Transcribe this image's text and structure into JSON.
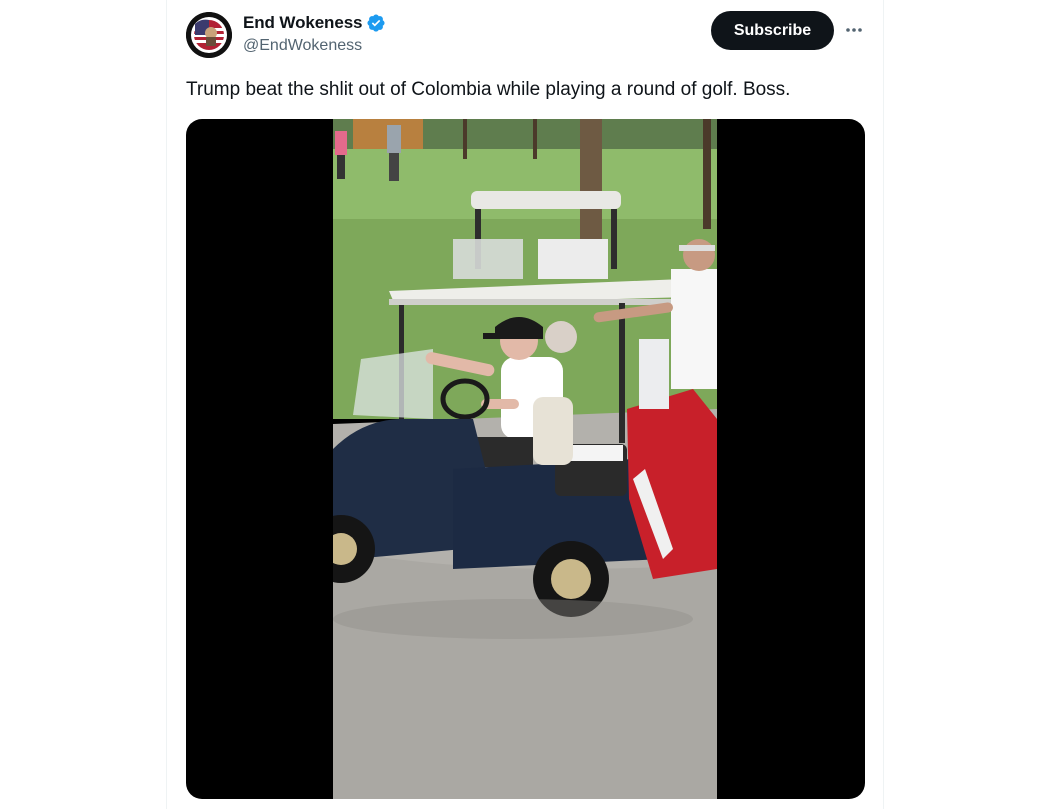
{
  "post": {
    "author": {
      "display_name": "End Wokeness",
      "handle": "@EndWokeness",
      "avatar_icon": "end-wokeness-logo",
      "verified": true,
      "verified_color": "#1d9bf0"
    },
    "subscribe_label": "Subscribe",
    "more_icon": "more-horizontal-icon",
    "text": "Trump beat the shlit out of Colombia while playing a round of golf. Boss.",
    "media": {
      "kind": "video",
      "scene": "golf cart on a paved path beside a golf course"
    }
  },
  "colors": {
    "text_primary": "#0f1419",
    "text_secondary": "#536471",
    "button_bg": "#0f1419",
    "button_text": "#ffffff",
    "media_bg": "#000000"
  }
}
